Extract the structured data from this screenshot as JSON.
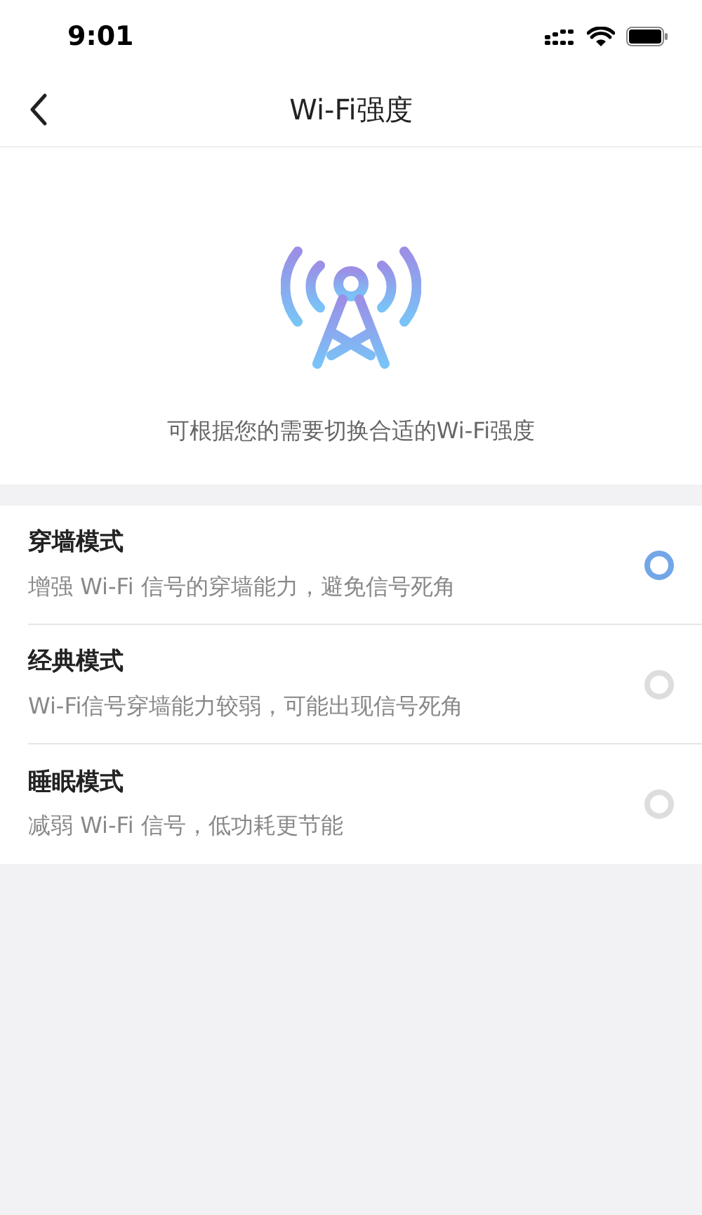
{
  "status_bar": {
    "time": "9:01"
  },
  "nav": {
    "title": "Wi-Fi强度"
  },
  "hero": {
    "caption": "可根据您的需要切换合适的Wi-Fi强度"
  },
  "modes": [
    {
      "title": "穿墙模式",
      "description": "增强 Wi-Fi 信号的穿墙能力，避免信号死角",
      "selected": true
    },
    {
      "title": "经典模式",
      "description": "Wi-Fi信号穿墙能力较弱，可能出现信号死角",
      "selected": false
    },
    {
      "title": "睡眠模式",
      "description": "减弱 Wi-Fi 信号，低功耗更节能",
      "selected": false
    }
  ]
}
